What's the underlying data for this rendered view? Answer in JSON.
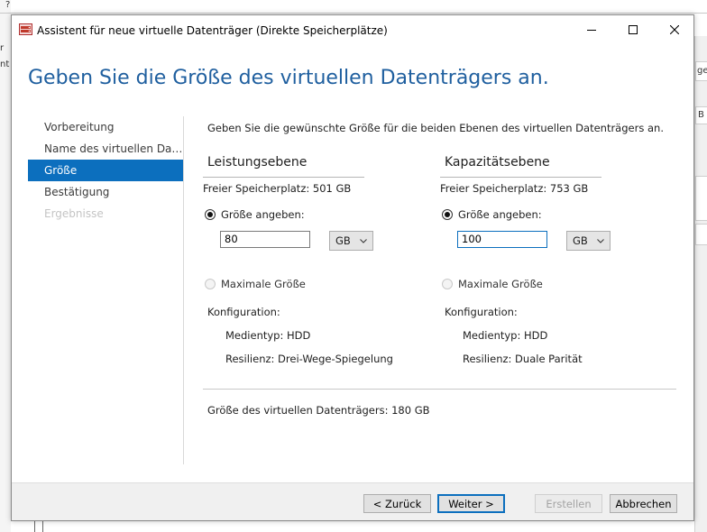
{
  "background": {
    "left_fragment_1": "?",
    "left_fragment_2": "r",
    "left_fragment_3": "nt",
    "right_fragment_1": "ge",
    "right_fragment_2": "B"
  },
  "window": {
    "title": "Assistent für neue virtuelle Datenträger (Direkte Speicherplätze)",
    "heading": "Geben Sie die Größe des virtuellen Datenträgers an."
  },
  "nav": {
    "items": [
      {
        "label": "Vorbereitung",
        "state": "normal"
      },
      {
        "label": "Name des virtuellen Datenträgers",
        "state": "normal"
      },
      {
        "label": "Größe",
        "state": "active"
      },
      {
        "label": "Bestätigung",
        "state": "normal"
      },
      {
        "label": "Ergebnisse",
        "state": "disabled"
      }
    ]
  },
  "main": {
    "intro": "Geben Sie die gewünschte Größe für die beiden Ebenen des virtuellen Datenträgers an.",
    "performance": {
      "title": "Leistungsebene",
      "free_space": "Freier Speicherplatz: 501 GB",
      "specify_label": "Größe angeben:",
      "size_value": "80",
      "unit": "GB",
      "max_label": "Maximale Größe",
      "config_label": "Konfiguration:",
      "media_type": "Medientyp: HDD",
      "resiliency": "Resilienz: Drei-Wege-Spiegelung"
    },
    "capacity": {
      "title": "Kapazitätsebene",
      "free_space": "Freier Speicherplatz: 753 GB",
      "specify_label": "Größe angeben:",
      "size_value": "100",
      "unit": "GB",
      "max_label": "Maximale Größe",
      "config_label": "Konfiguration:",
      "media_type": "Medientyp: HDD",
      "resiliency": "Resilienz: Duale Parität"
    },
    "total": "Größe des virtuellen Datenträgers: 180 GB"
  },
  "footer": {
    "back": "< Zurück",
    "next": "Weiter >",
    "create": "Erstellen",
    "cancel": "Abbrechen"
  },
  "colors": {
    "accent": "#0c6fbe",
    "heading": "#1f5f9f"
  }
}
